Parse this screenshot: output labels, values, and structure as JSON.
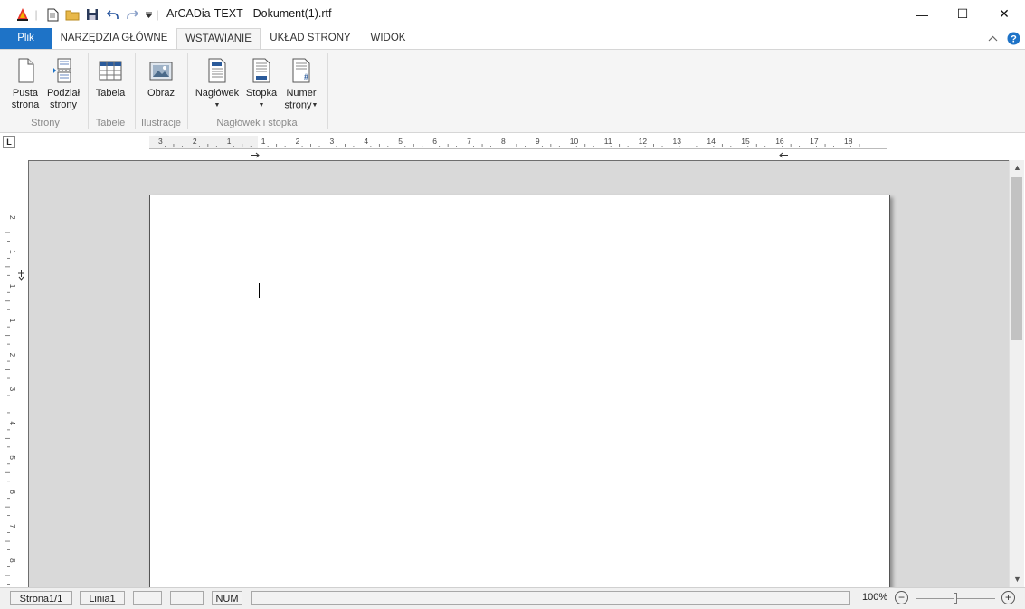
{
  "window": {
    "title": "ArCADia-TEXT - Dokument(1).rtf",
    "minimize_glyph": "—",
    "maximize_glyph": "☐",
    "close_glyph": "✕"
  },
  "quick_access": {
    "icons": [
      "app-logo-icon",
      "new-document-icon",
      "open-folder-icon",
      "save-icon",
      "undo-icon",
      "redo-icon",
      "customize-qat-icon"
    ]
  },
  "tabs": {
    "file": "Plik",
    "home": "NARZĘDZIA GŁÓWNE",
    "insert": "WSTAWIANIE",
    "layout": "UKŁAD STRONY",
    "view": "WIDOK",
    "active": "WSTAWIANIE"
  },
  "ribbon": {
    "blank_page": {
      "line1": "Pusta",
      "line2": "strona"
    },
    "page_break": {
      "line1": "Podział",
      "line2": "strony"
    },
    "table": "Tabela",
    "picture": "Obraz",
    "header": "Nagłówek",
    "footer": "Stopka",
    "page_number": {
      "line1": "Numer",
      "line2": "strony"
    },
    "groups": {
      "pages": "Strony",
      "tables": "Tabele",
      "illustrations": "Ilustracje",
      "header_footer": "Nagłówek i stopka"
    }
  },
  "ruler": {
    "h_labels": [
      "3",
      "2",
      "1",
      "1",
      "2",
      "3",
      "4",
      "5",
      "6",
      "7",
      "8",
      "9",
      "10",
      "11",
      "12",
      "13",
      "14",
      "15",
      "16",
      "17",
      "18"
    ],
    "v_labels": [
      "2",
      "1",
      "1",
      "1",
      "2",
      "3",
      "4",
      "5",
      "6",
      "7",
      "8"
    ]
  },
  "statusbar": {
    "page": "Strona1/1",
    "line": "Linia1",
    "num": "NUM",
    "zoom": "100%",
    "zoom_out_glyph": "−",
    "zoom_in_glyph": "+"
  },
  "colors": {
    "accent": "#1e73c7",
    "workspace": "#d9d9d9",
    "ribbon_bg": "#f5f5f5"
  }
}
